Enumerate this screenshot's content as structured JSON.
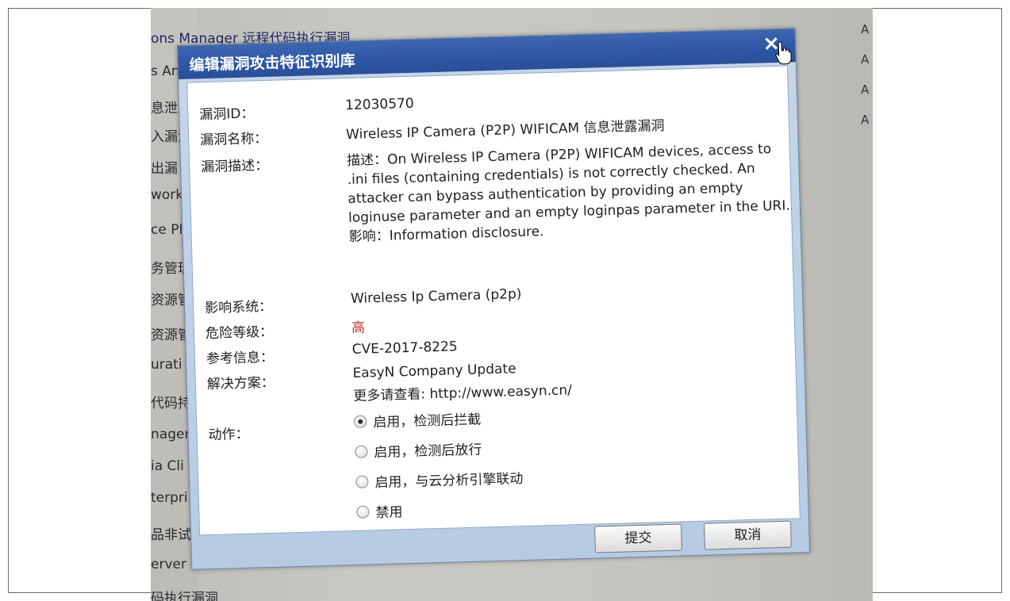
{
  "background_window": {
    "top_line": "ons Manager 远程代码执行漏洞",
    "left_rows": [
      "s Ana",
      "息泄漏",
      "入漏洞",
      "出漏",
      "work",
      "ce Pl",
      "务管理",
      "资源管",
      "资源管",
      "urati",
      "代码持",
      "nager",
      "ia Cli",
      "terpri",
      "品非试",
      "erver"
    ],
    "bottom_line": "码执行漏洞",
    "right_letters": [
      "A",
      "A",
      "A",
      "A"
    ]
  },
  "dialog": {
    "title": "编辑漏洞攻击特征识别库",
    "close_icon": "close-icon",
    "fields": {
      "id_label": "漏洞ID：",
      "id_value": "12030570",
      "name_label": "漏洞名称：",
      "name_value": "Wireless IP Camera (P2P) WIFICAM 信息泄露漏洞",
      "desc_label": "漏洞描述：",
      "desc_line1": "描述：On Wireless IP Camera (P2P) WIFICAM devices, access to .ini files (containing credentials) is not correctly checked. An attacker can bypass authentication by providing an empty loginuse parameter and an empty loginpas parameter in the URI.",
      "desc_line2": "影响：Information disclosure.",
      "system_label": "影响系统：",
      "system_value": "Wireless Ip Camera (p2p)",
      "level_label": "危险等级：",
      "level_value": "高",
      "ref_label": "参考信息：",
      "ref_value": "CVE-2017-8225",
      "solution_label": "解决方案：",
      "solution_value": "EasyN Company Update",
      "more_prefix": "更多请查看: ",
      "more_link": "http://www.easyn.cn/",
      "action_label": "动作："
    },
    "actions": [
      {
        "label": "启用，检测后拦截",
        "checked": true
      },
      {
        "label": "启用，检测后放行",
        "checked": false
      },
      {
        "label": "启用，与云分析引擎联动",
        "checked": false
      },
      {
        "label": "禁用",
        "checked": false
      }
    ],
    "buttons": {
      "submit": "提交",
      "cancel": "取消"
    }
  },
  "colors": {
    "title_bar": "#2f58a8",
    "danger": "#c0302a"
  }
}
